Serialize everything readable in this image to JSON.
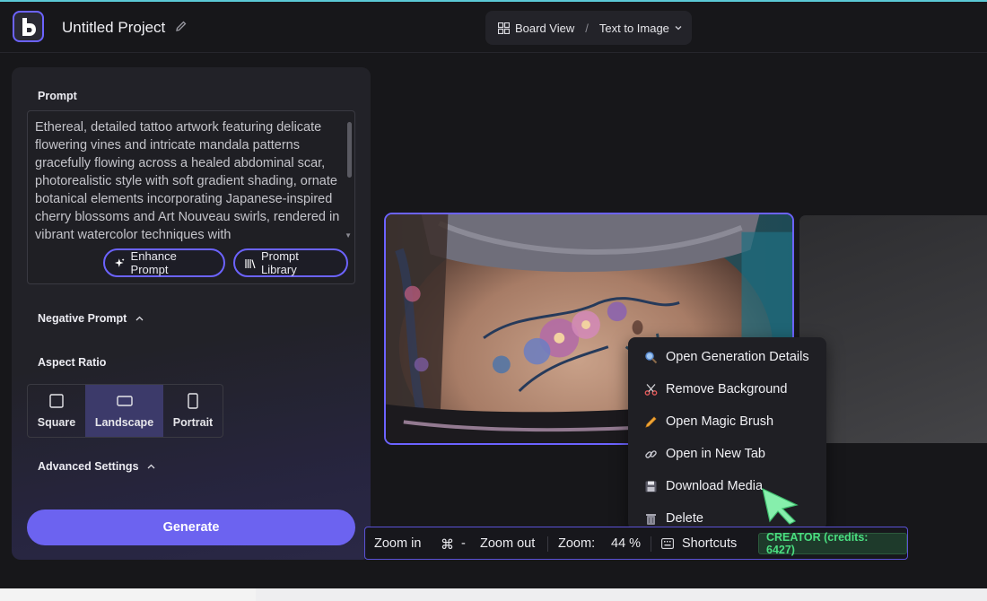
{
  "header": {
    "project_title": "Untitled Project",
    "view_label": "Board View",
    "separator": "/",
    "mode_label": "Text to Image"
  },
  "panel": {
    "prompt_label": "Prompt",
    "prompt_text": "Ethereal, detailed tattoo artwork featuring delicate flowering vines and intricate mandala patterns gracefully flowing across a healed abdominal scar, photorealistic style with soft gradient shading, ornate botanical elements incorporating Japanese-inspired cherry blossoms and Art Nouveau swirls, rendered in vibrant watercolor techniques with",
    "enhance_label": "Enhance Prompt",
    "library_label": "Prompt Library",
    "negative_label": "Negative Prompt",
    "aspect_label": "Aspect Ratio",
    "aspect_options": [
      {
        "label": "Square",
        "selected": false
      },
      {
        "label": "Landscape",
        "selected": true
      },
      {
        "label": "Portrait",
        "selected": false
      }
    ],
    "advanced_label": "Advanced Settings",
    "generate_label": "Generate"
  },
  "context_menu": {
    "items": [
      {
        "label": "Open Generation Details",
        "icon": "magnifier-icon"
      },
      {
        "label": "Remove Background",
        "icon": "scissors-icon"
      },
      {
        "label": "Open Magic Brush",
        "icon": "pencil-icon"
      },
      {
        "label": "Open in New Tab",
        "icon": "link-icon"
      },
      {
        "label": "Download Media",
        "icon": "floppy-disk-icon"
      },
      {
        "label": "Delete",
        "icon": "trash-icon"
      }
    ]
  },
  "toolbar": {
    "zoom_in_label": "Zoom in",
    "cmd_key": "⌘",
    "minus_key": "-",
    "zoom_out_label": "Zoom out",
    "zoom_label": "Zoom:",
    "zoom_value": "44 %",
    "shortcuts_label": "Shortcuts",
    "credits_label": "CREATOR (credits: 6427)"
  },
  "colors": {
    "accent": "#6c63ff",
    "credits_green": "#4ade80",
    "cursor_green": "#86efac"
  }
}
